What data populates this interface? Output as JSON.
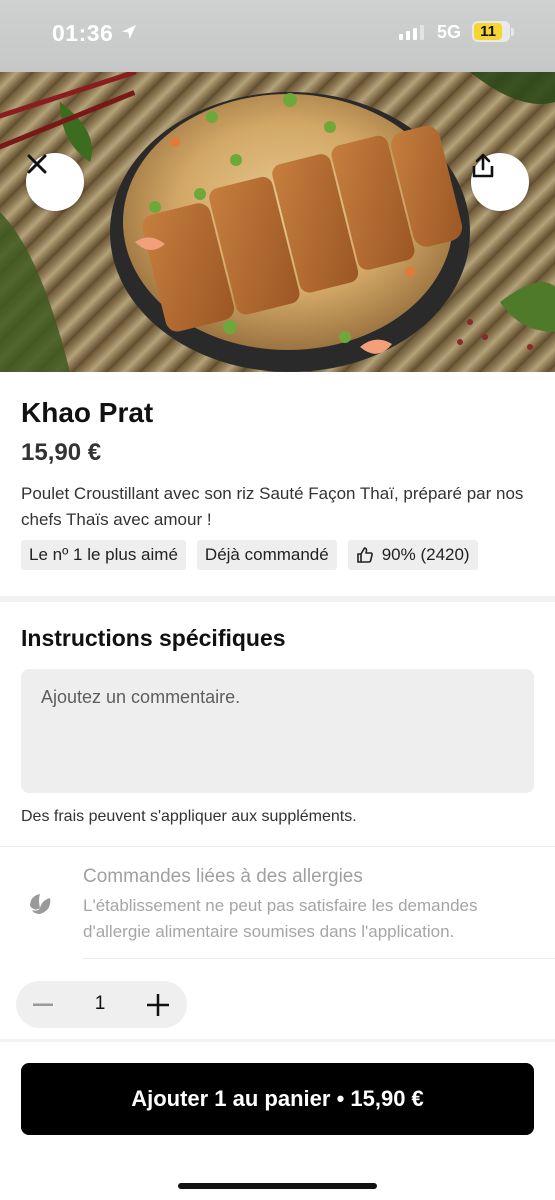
{
  "status_bar": {
    "time": "01:36",
    "network": "5G",
    "battery": "11",
    "icons": [
      "location-arrow-icon",
      "signal-icon",
      "battery-icon"
    ]
  },
  "hero": {
    "close_icon": "close-icon",
    "share_icon": "share-icon"
  },
  "item": {
    "title": "Khao Prat",
    "price": "15,90 €",
    "description": "Poulet Croustillant avec son riz Sauté Façon Thaï, préparé par nos chefs Thaïs avec amour !",
    "tags": [
      {
        "label": "Le nº 1 le plus aimé"
      },
      {
        "label": "Déjà commandé"
      },
      {
        "label": "90% (2420)",
        "icon": "thumbs-up-icon"
      }
    ]
  },
  "instructions": {
    "title": "Instructions spécifiques",
    "placeholder": "Ajoutez un commentaire.",
    "fees_note": "Des frais peuvent s'appliquer aux suppléments."
  },
  "allergy": {
    "icon": "leaf-icon",
    "title": "Commandes liées à des allergies",
    "text": "L'établissement ne peut pas satisfaire les demandes d'allergie alimentaire soumises dans l'application."
  },
  "quantity": {
    "value": "1",
    "minus_icon": "minus-icon",
    "plus_icon": "plus-icon"
  },
  "cart_button": {
    "label": "Ajouter 1 au panier • 15,90 €",
    "background": "#000000"
  },
  "colors": {
    "tag_background": "#eeeeee",
    "input_background": "#eeeeee",
    "muted_text": "#a0a0a0"
  }
}
